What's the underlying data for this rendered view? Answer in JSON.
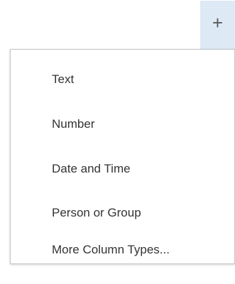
{
  "add_button": {
    "icon": "plus-icon",
    "glyph": "+"
  },
  "menu": {
    "items": [
      {
        "label": "Text"
      },
      {
        "label": "Number"
      },
      {
        "label": "Date and Time"
      },
      {
        "label": "Person or Group"
      },
      {
        "label": "More Column Types..."
      }
    ]
  },
  "colors": {
    "add_button_bg": "#dde9f5",
    "menu_border": "#c6c6c6",
    "text": "#333333"
  }
}
